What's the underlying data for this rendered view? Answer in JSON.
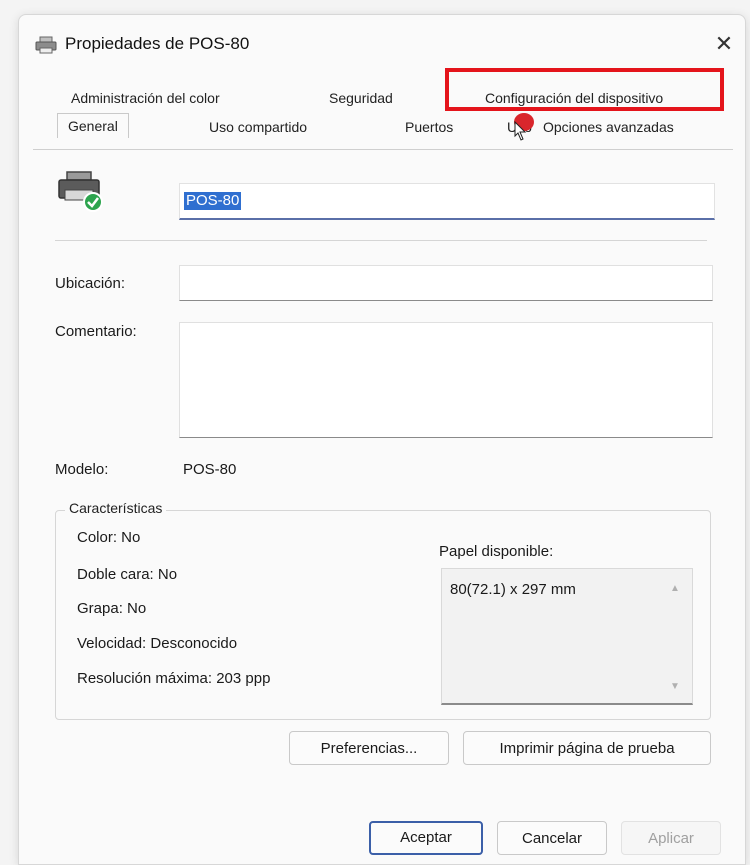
{
  "window": {
    "title": "Propiedades de POS-80",
    "close_glyph": "✕"
  },
  "tabs": {
    "row1": [
      "Administración del color",
      "Seguridad",
      "Configuración del dispositivo"
    ],
    "row2": [
      "General",
      "Uso compartido",
      "Puertos",
      "Opciones avanzadas"
    ],
    "row2_partial": "Uso",
    "active": "General"
  },
  "general": {
    "printer_name": "POS-80",
    "location_label": "Ubicación:",
    "location_value": "",
    "comment_label": "Comentario:",
    "comment_value": "",
    "model_label": "Modelo:",
    "model_value": "POS-80"
  },
  "features": {
    "group_title": "Características",
    "color": "Color: No",
    "duplex": "Doble cara: No",
    "staple": "Grapa: No",
    "speed": "Velocidad: Desconocido",
    "resolution": "Resolución máxima: 203 ppp",
    "paper_label": "Papel disponible:",
    "paper_items": [
      "80(72.1) x 297 mm"
    ]
  },
  "buttons": {
    "preferences": "Preferencias...",
    "print_test": "Imprimir página de prueba",
    "ok": "Aceptar",
    "cancel": "Cancelar",
    "apply": "Aplicar"
  },
  "icons": {
    "title": "printer-icon",
    "device": "printer-ready-icon",
    "close": "close-icon"
  },
  "colors": {
    "highlight": "#e4141b",
    "selection": "#2f6fd0",
    "status_ok": "#2da44e"
  }
}
